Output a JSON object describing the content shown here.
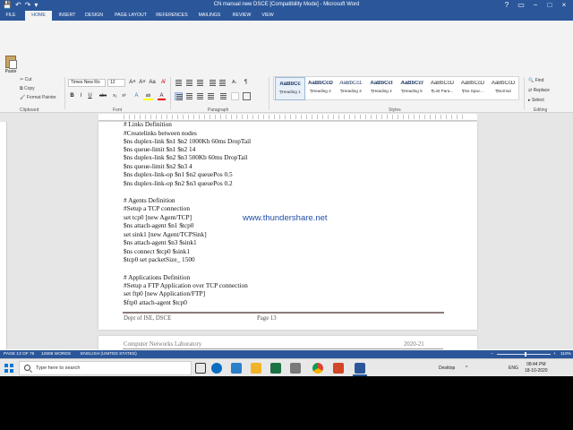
{
  "window": {
    "title": "CN manual new DSCE [Compatibility Mode] - Microsoft Word",
    "controls": [
      "?",
      "▭",
      "−",
      "□",
      "×"
    ]
  },
  "qat": {
    "save": "💾",
    "undo": "↶",
    "redo": "↷",
    "extra": "▾"
  },
  "tabs": [
    {
      "label": "FILE"
    },
    {
      "label": "HOME"
    },
    {
      "label": "INSERT"
    },
    {
      "label": "DESIGN"
    },
    {
      "label": "PAGE LAYOUT"
    },
    {
      "label": "REFERENCES"
    },
    {
      "label": "MAILINGS"
    },
    {
      "label": "REVIEW"
    },
    {
      "label": "VIEW"
    }
  ],
  "ribbon": {
    "clipboard": {
      "paste": "Paste",
      "cut": "Cut",
      "copy": "Copy",
      "format_painter": "Format Painter",
      "label": "Clipboard"
    },
    "font": {
      "name": "Times New Ro",
      "size": "12",
      "grow": "A˄",
      "shrink": "A˅",
      "case": "Aa",
      "clear": "A̸",
      "bold": "B",
      "italic": "I",
      "underline": "U",
      "strike": "abc",
      "sub": "x₂",
      "sup": "x²",
      "effects": "A",
      "highlight": "ab",
      "color": "A",
      "label": "Font"
    },
    "paragraph": {
      "label": "Paragraph",
      "sort": "A↓",
      "pilcrow": "¶"
    },
    "styles": {
      "label": "Styles",
      "items": [
        {
          "sample": "AaBbCc",
          "name": "¶Heading 1"
        },
        {
          "sample": "AaBbCcD",
          "name": "¶Heading 2"
        },
        {
          "sample": "AaBbCcL",
          "name": "¶Heading 3"
        },
        {
          "sample": "AaBbCcI",
          "name": "¶Heading 4"
        },
        {
          "sample": "AaBbCcl",
          "name": "¶Heading 5"
        },
        {
          "sample": "AaBbCcD",
          "name": "¶List Para..."
        },
        {
          "sample": "AaBbCcD",
          "name": "¶No Spac..."
        },
        {
          "sample": "AaBbCcD",
          "name": "¶Normal"
        }
      ]
    },
    "editing": {
      "find": "Find",
      "replace": "Replace",
      "select": "Select",
      "label": "Editing"
    }
  },
  "document": {
    "lines": [
      "# Links Definition",
      "#Createlinks between nodes",
      "$ns duplex-link $n1 $n2 1000Kb 60ms DropTail",
      "$ns queue-limit $n1 $n2 14",
      "$ns duplex-link $n2 $n3 500Kb 60ms DropTail",
      "$ns queue-limit $n2 $n3 4",
      "$ns duplex-link-op $n1 $n2 queuePos 0.5",
      "$ns duplex-link-op $n2 $n3 queuePos 0.2",
      "",
      "# Agents Definition",
      "#Setup a TCP connection",
      "set tcp0 [new Agent/TCP]",
      "$ns attach-agent $n1 $tcp0",
      "set sink1 [new Agent/TCPSink]",
      "$ns attach-agent $n3 $sink1",
      "$ns connect $tcp0 $sink1",
      "$tcp0 set packetSize_ 1500",
      "",
      "# Applications Definition",
      "#Setup a FTP Application over TCP connection",
      "set ftp0 [new Application/FTP]",
      "$ftp0 attach-agent $tcp0"
    ],
    "watermark": "www.thundershare.net",
    "footer_left": "Dept of ISE, DSCE",
    "footer_page": "Page 13",
    "next_header_left": "Computer Networks Laboratory",
    "next_header_right": "2020-21"
  },
  "status": {
    "page": "PAGE 13 OF 75",
    "words": "12608 WORDS",
    "lang": "ENGLISH (UNITED STATES)",
    "zoom": "110%",
    "zoom_minus": "−",
    "zoom_plus": "+"
  },
  "taskbar": {
    "search_placeholder": "Type here to search",
    "desktop": "Desktop",
    "tray_arrows": "^",
    "lang": "ENG",
    "time": "08:44 PM",
    "date": "18-10-2020"
  }
}
